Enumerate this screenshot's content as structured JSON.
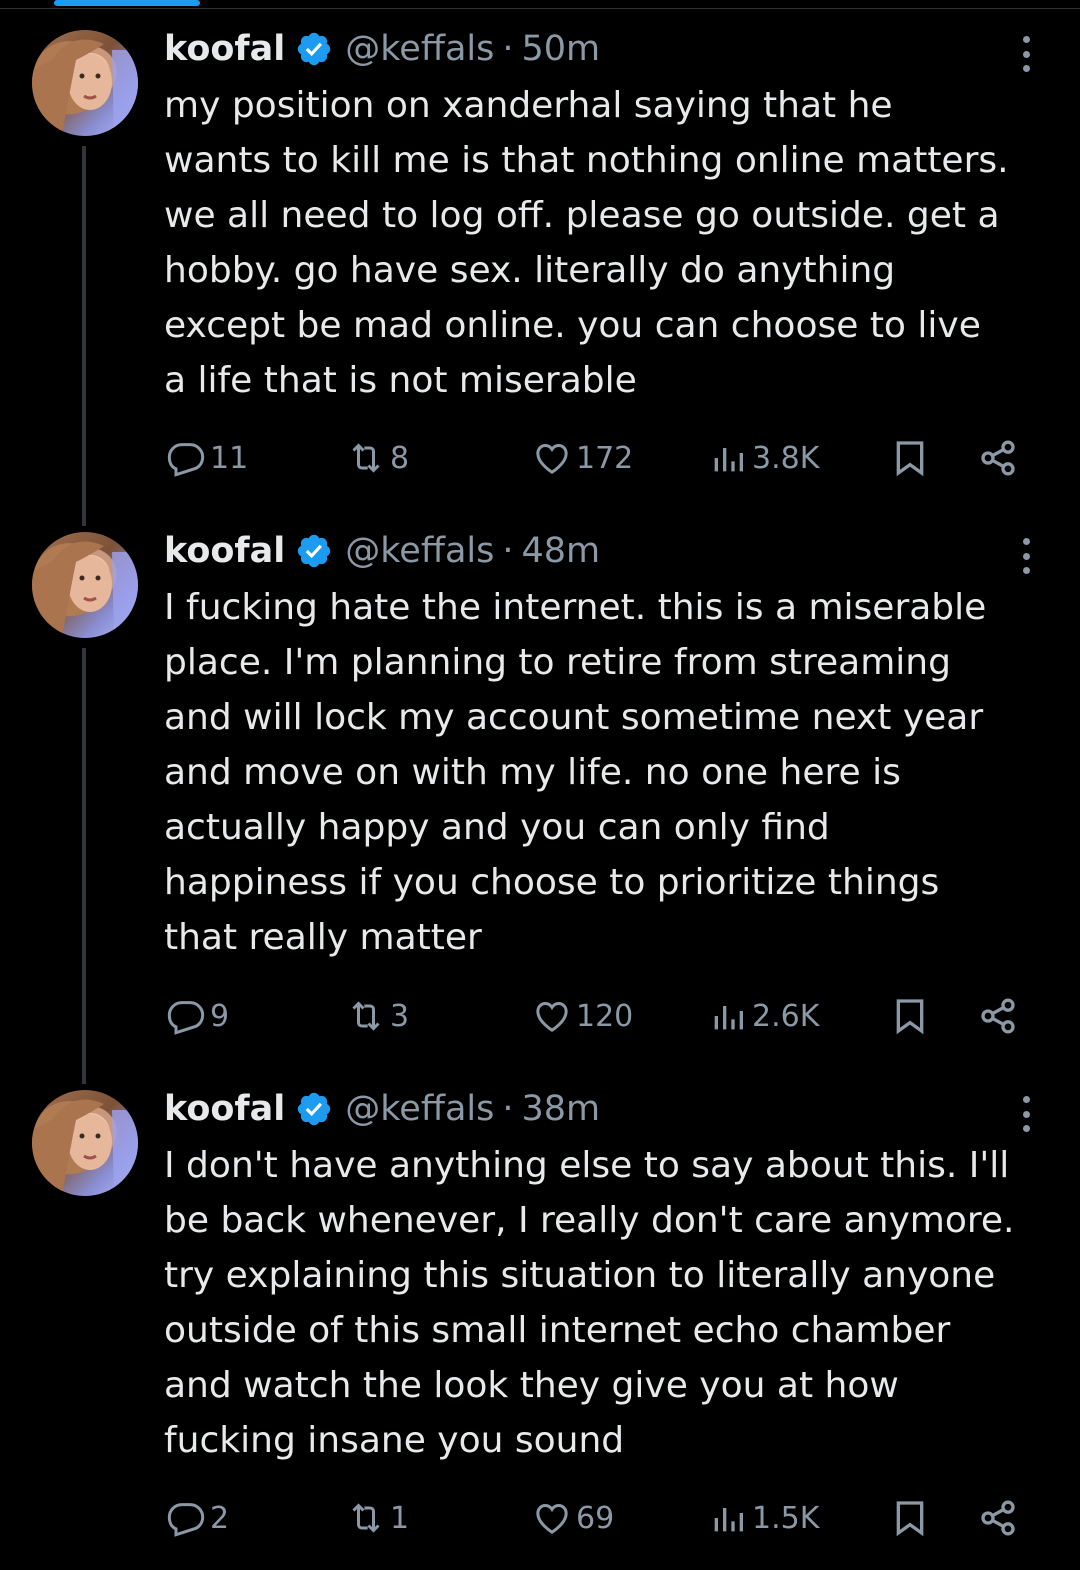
{
  "tweets": [
    {
      "name": "koofal",
      "handle": "@keffals",
      "dot": "·",
      "time": "50m",
      "text": "my position on xanderhal saying that he\nwants to kill me is that nothing online matters.\nwe all need to log off. please go outside. get a\nhobby. go have sex. literally do anything\nexcept be mad online. you can choose to live\na life that is not miserable",
      "replies": "11",
      "reposts": "8",
      "likes": "172",
      "views": "3.8K"
    },
    {
      "name": "koofal",
      "handle": "@keffals",
      "dot": "·",
      "time": "48m",
      "text": "I fucking hate the internet. this is a miserable\nplace. I'm planning to retire from streaming\nand will lock my account sometime next year\nand move on with my life. no one here is\nactually happy and you can only find\nhappiness if you choose to prioritize things\nthat really matter",
      "replies": "9",
      "reposts": "3",
      "likes": "120",
      "views": "2.6K"
    },
    {
      "name": "koofal",
      "handle": "@keffals",
      "dot": "·",
      "time": "38m",
      "text": "I don't have anything else to say about this. I'll\nbe back whenever, I really don't care anymore.\ntry explaining this situation to literally anyone\noutside of this small internet echo chamber\nand watch the look they give you at how\nfucking insane you sound",
      "replies": "2",
      "reposts": "1",
      "likes": "69",
      "views": "1.5K"
    }
  ],
  "colors": {
    "background": "#000000",
    "text": "#e7e9ea",
    "secondary": "#8b98a5",
    "verified": "#1d9bf0"
  },
  "icons": [
    "verified-badge-icon",
    "more-icon",
    "reply-icon",
    "repost-icon",
    "like-icon",
    "views-icon",
    "bookmark-icon",
    "share-icon"
  ]
}
